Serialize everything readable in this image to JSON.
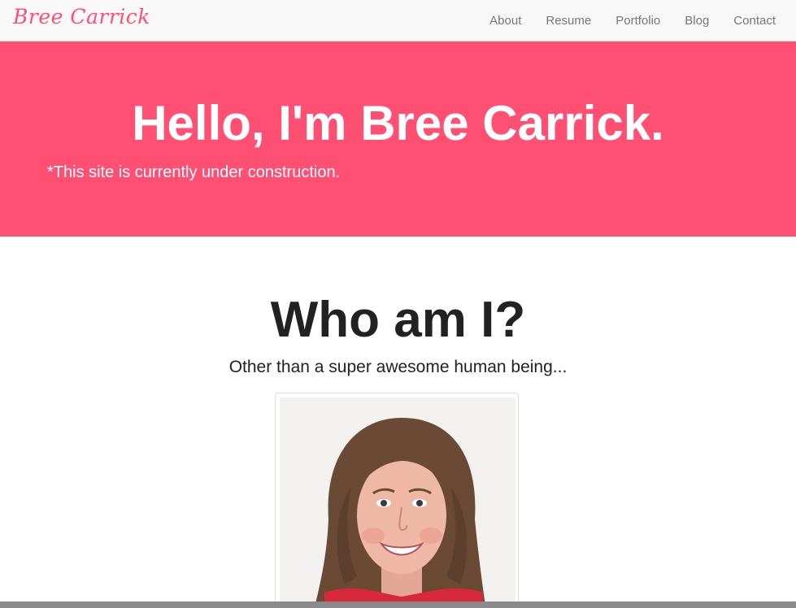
{
  "nav": {
    "brand": "Bree Carrick",
    "links": [
      "About",
      "Resume",
      "Portfolio",
      "Blog",
      "Contact"
    ]
  },
  "hero": {
    "title": "Hello, I'm Bree Carrick.",
    "note": "*This site is currently under construction.",
    "background_color": "#ff5073"
  },
  "about": {
    "title": "Who am I?",
    "subtitle": "Other than a super awesome human being..."
  },
  "colors": {
    "accent": "#ff5073",
    "navbar_bg": "#f8f8f8",
    "nav_text": "#777777",
    "body_text": "#222222"
  }
}
